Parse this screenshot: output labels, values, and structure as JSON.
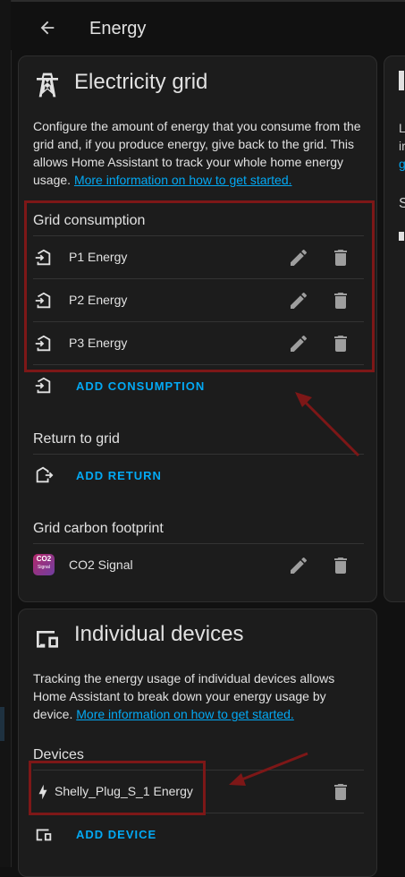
{
  "header": {
    "title": "Energy",
    "back_icon": "arrow-left-icon"
  },
  "grid": {
    "title": "Electricity grid",
    "icon": "transmission-tower-icon",
    "description": "Configure the amount of energy that you consume from the grid and, if you produce energy, give back to the grid. This allows Home Assistant to track your whole home energy usage.",
    "link": "More information on how to get started.",
    "consumption": {
      "label": "Grid consumption",
      "items": [
        {
          "label": "P1 Energy"
        },
        {
          "label": "P2 Energy"
        },
        {
          "label": "P3 Energy"
        }
      ],
      "add_label": "ADD CONSUMPTION"
    },
    "return": {
      "label": "Return to grid",
      "add_label": "ADD RETURN"
    },
    "carbon": {
      "label": "Grid carbon footprint",
      "item": "CO2 Signal",
      "badge_main": "CO2",
      "badge_sub": "Signal"
    }
  },
  "devices": {
    "title": "Individual devices",
    "icon": "devices-icon",
    "description": "Tracking the energy usage of individual devices allows Home Assistant to break down your energy usage by device.",
    "link": "More information on how to get started.",
    "label": "Devices",
    "items": [
      {
        "label": "Shelly_Plug_S_1 Energy"
      }
    ],
    "add_label": "ADD DEVICE"
  },
  "side_card": {
    "t1": "L",
    "t2": "ir",
    "t3": "g",
    "t4": "S"
  },
  "colors": {
    "accent": "#03a9f4",
    "annotation": "#7d1717",
    "card": "#1c1c1c"
  }
}
